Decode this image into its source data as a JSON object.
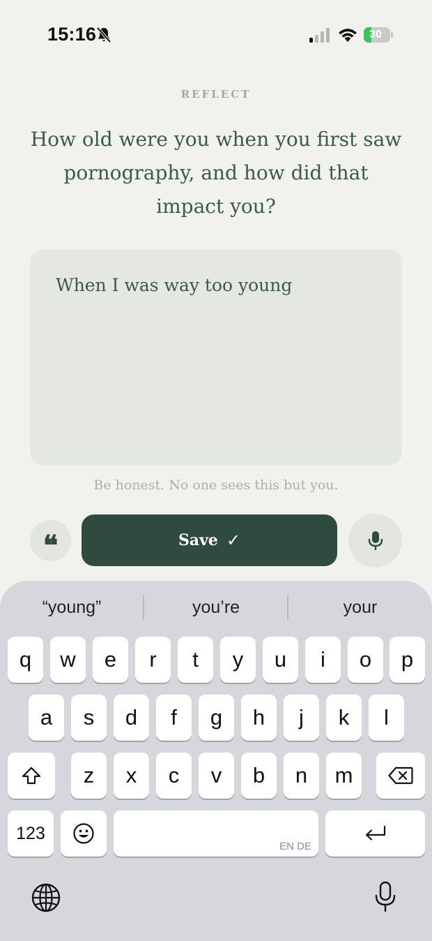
{
  "status_bar": {
    "time": "15:16",
    "battery": "30",
    "battery_level": 0.3,
    "colors": {
      "battery_fill": "#35c759"
    },
    "icons": [
      "bell-slash-icon",
      "cellular-signal-icon",
      "wifi-icon",
      "battery-charging-icon"
    ]
  },
  "screen": {
    "section_label": "REFLECT",
    "question": "How old were you when you first saw pornography, and how did that impact you?",
    "answer_value": "When I was way too young",
    "hint": "Be honest. No one sees this but you.",
    "save_label": "Save",
    "save_check": "✓",
    "quote_glyph": "❝",
    "colors": {
      "accent": "#2f4a3f",
      "background": "#f1f1ed",
      "card": "#e5e7e1"
    }
  },
  "keyboard": {
    "suggestions": [
      "“young”",
      "you’re",
      "your"
    ],
    "row1": [
      "q",
      "w",
      "e",
      "r",
      "t",
      "y",
      "u",
      "i",
      "o",
      "p"
    ],
    "row2": [
      "a",
      "s",
      "d",
      "f",
      "g",
      "h",
      "j",
      "k",
      "l"
    ],
    "row3": [
      "z",
      "x",
      "c",
      "v",
      "b",
      "n",
      "m"
    ],
    "numbers_label": "123",
    "space_languages": "EN DE",
    "icons": [
      "shift-icon",
      "backspace-icon",
      "emoji-icon",
      "return-icon",
      "globe-icon",
      "dictation-mic-icon"
    ]
  }
}
